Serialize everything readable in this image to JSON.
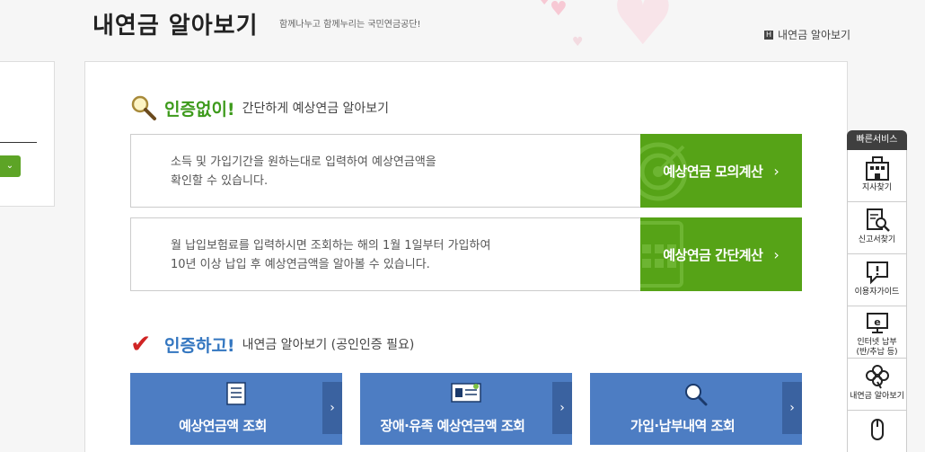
{
  "header": {
    "title": "내연금 알아보기",
    "subtitle": "함께나누고 함께누리는 국민연금공단!",
    "breadcrumb": "내연금 알아보기",
    "breadcrumb_icon": "home-icon"
  },
  "section_no_cert": {
    "em": "인증없이!",
    "rest": "간단하게 예상연금 알아보기",
    "icon": "magnifier-icon",
    "boxes": [
      {
        "desc_line1": "소득 및 가입기간을 원하는대로 입력하여 예상연금액을",
        "desc_line2": "확인할 수 있습니다.",
        "button": "예상연금 모의계산",
        "icon": "target-icon"
      },
      {
        "desc_line1": "월 납입보험료를 입력하시면 조회하는 해의 1월 1일부터 가입하여",
        "desc_line2": "10년 이상 납입 후 예상연금액을 알아볼 수 있습니다.",
        "button": "예상연금 간단계산",
        "icon": "calculator-icon"
      }
    ]
  },
  "section_cert": {
    "em": "인증하고!",
    "rest": "내연금 알아보기 (공인인증 필요)",
    "icon": "checkmark-icon",
    "cards": [
      {
        "label": "예상연금액 조회",
        "icon": "document-icon"
      },
      {
        "label": "장애·유족 예상연금액 조회",
        "icon": "id-card-icon"
      },
      {
        "label": "가입·납부내역 조회",
        "icon": "search-icon"
      }
    ]
  },
  "quick_service": {
    "title": "빠른서비스",
    "items": [
      {
        "label": "지사찾기",
        "icon": "building-icon"
      },
      {
        "label": "신고서찾기",
        "icon": "document-search-icon"
      },
      {
        "label": "이용자가이드",
        "icon": "speech-bubble-icon"
      },
      {
        "label": "인터넷 납부\n(반/추납 등)",
        "icon": "monitor-e-icon"
      },
      {
        "label": "내연금 알아보기",
        "icon": "clover-icon"
      },
      {
        "label": "",
        "icon": "mouse-icon"
      }
    ]
  },
  "colors": {
    "green": "#56a317",
    "blue": "#4d7dc3",
    "check_red": "#d02424"
  }
}
